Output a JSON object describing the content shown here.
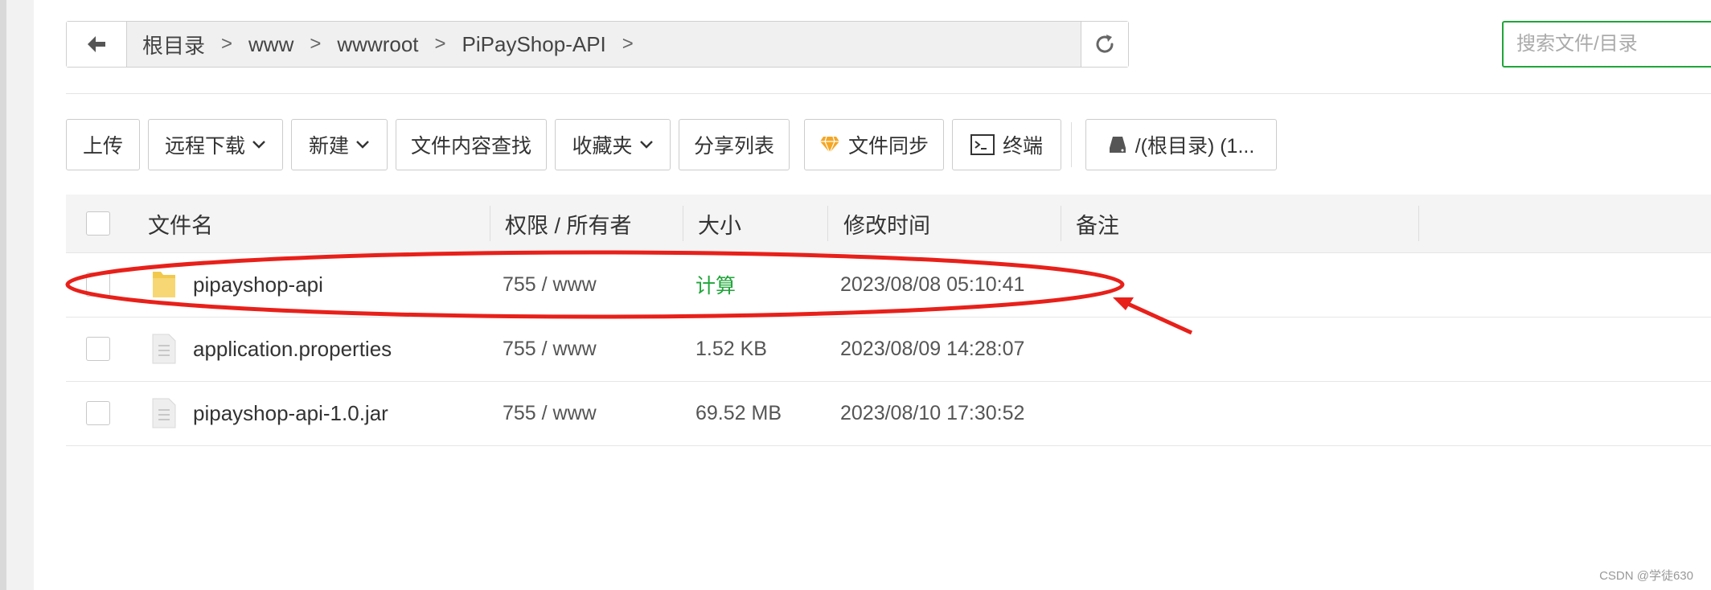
{
  "breadcrumb": {
    "items": [
      "根目录",
      "www",
      "wwwroot",
      "PiPayShop-API"
    ],
    "separator": ">"
  },
  "search": {
    "placeholder": "搜索文件/目录"
  },
  "toolbar": {
    "upload": "上传",
    "remote_download": "远程下载",
    "new": "新建",
    "content_search": "文件内容查找",
    "favorites": "收藏夹",
    "share_list": "分享列表",
    "file_sync": "文件同步",
    "terminal": "终端",
    "disk": "/(根目录) (1..."
  },
  "table": {
    "columns": [
      "文件名",
      "权限 / 所有者",
      "大小",
      "修改时间",
      "备注"
    ],
    "rows": [
      {
        "type": "folder",
        "name": "pipayshop-api",
        "perm": "755 / www",
        "size": "计算",
        "mtime": "2023/08/08 05:10:41",
        "note": ""
      },
      {
        "type": "file",
        "name": "application.properties",
        "perm": "755 / www",
        "size": "1.52 KB",
        "mtime": "2023/08/09 14:28:07",
        "note": ""
      },
      {
        "type": "file",
        "name": "pipayshop-api-1.0.jar",
        "perm": "755 / www",
        "size": "69.52 MB",
        "mtime": "2023/08/10 17:30:52",
        "note": ""
      }
    ]
  },
  "watermark": "CSDN @学徒630",
  "colors": {
    "accent": "#20a53a",
    "annotation": "#e8201a"
  }
}
